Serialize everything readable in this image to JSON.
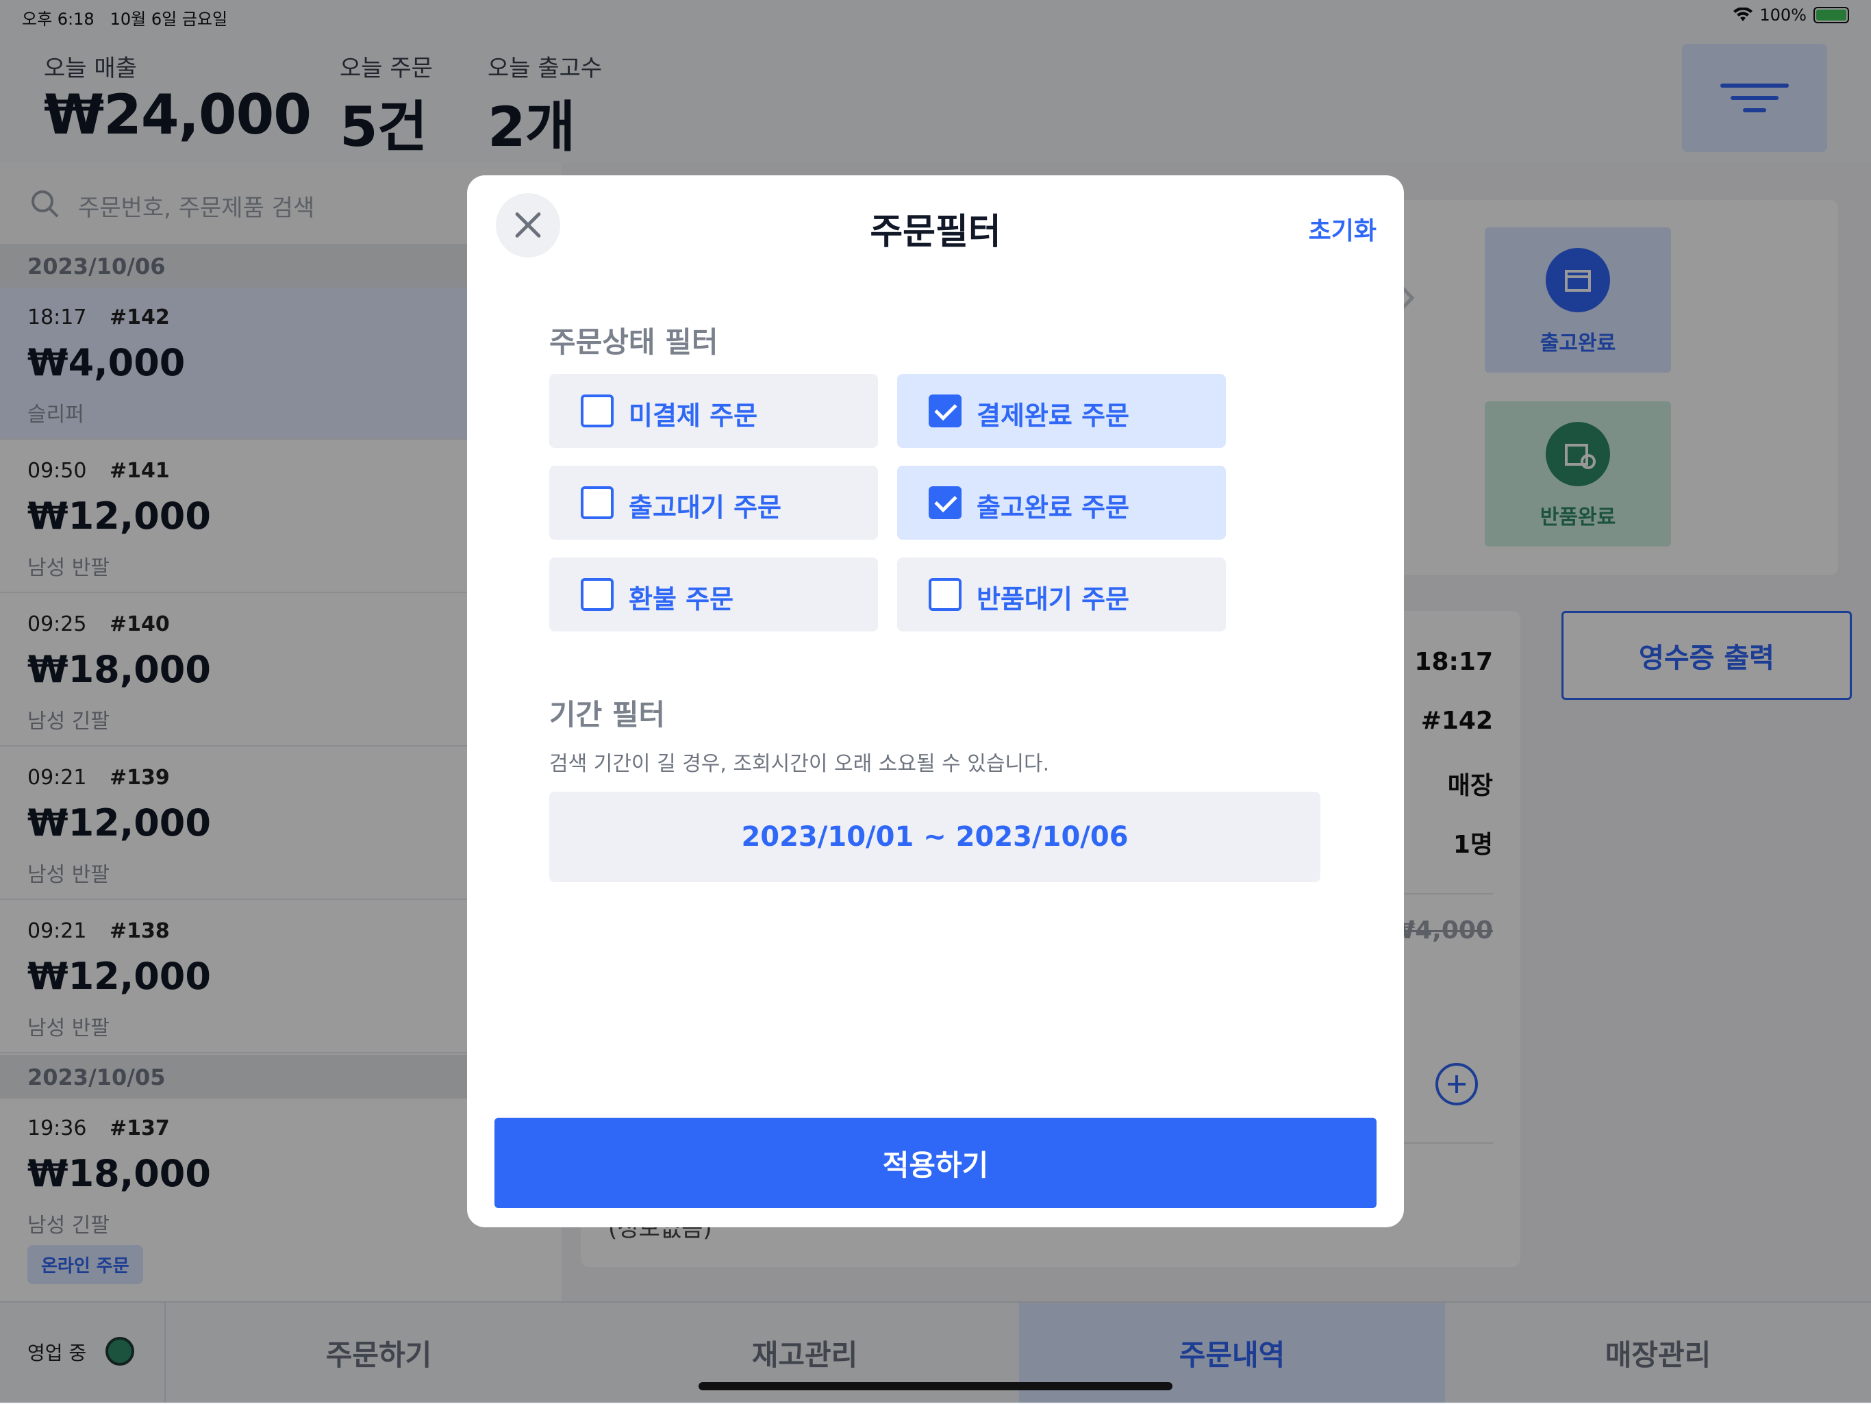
{
  "status_bar": {
    "time": "오후 6:18",
    "date": "10월 6일 금요일",
    "battery": "100%"
  },
  "header": {
    "sales_label": "오늘 매출",
    "sales_value": "₩24,000",
    "orders_label": "오늘 주문",
    "orders_value": "5건",
    "shipped_label": "오늘 출고수",
    "shipped_value": "2개"
  },
  "search": {
    "placeholder": "주문번호, 주문제품 검색"
  },
  "order_groups": [
    {
      "date": "2023/10/06",
      "orders": [
        {
          "time": "18:17",
          "number": "#142",
          "price": "₩4,000",
          "product": "슬리퍼"
        },
        {
          "time": "09:50",
          "number": "#141",
          "price": "₩12,000",
          "product": "남성 반팔"
        },
        {
          "time": "09:25",
          "number": "#140",
          "price": "₩18,000",
          "product": "남성 긴팔"
        },
        {
          "time": "09:21",
          "number": "#139",
          "price": "₩12,000",
          "product": "남성 반팔"
        },
        {
          "time": "09:21",
          "number": "#138",
          "price": "₩12,000",
          "product": "남성 반팔"
        }
      ]
    },
    {
      "date": "2023/10/05",
      "orders": [
        {
          "time": "19:36",
          "number": "#137",
          "price": "₩18,000",
          "product": "남성 긴팔",
          "tag": "온라인 주문"
        }
      ]
    }
  ],
  "detail": {
    "status_buttons": [
      {
        "label": "출고완료"
      },
      {
        "label": "반품완료"
      }
    ],
    "receipt_button": "영수증 출력",
    "rows": [
      "06, 18:17",
      "#142",
      "매장",
      "1명"
    ],
    "original_price": "₩4,000",
    "memo": "(정보없음)"
  },
  "modal": {
    "title": "주문필터",
    "reset": "초기화",
    "status_section": "주문상태 필터",
    "status_options": [
      {
        "label": "미결제 주문",
        "checked": false
      },
      {
        "label": "결제완료 주문",
        "checked": true
      },
      {
        "label": "출고대기 주문",
        "checked": false
      },
      {
        "label": "출고완료 주문",
        "checked": true
      },
      {
        "label": "환불 주문",
        "checked": false
      },
      {
        "label": "반품대기 주문",
        "checked": false
      }
    ],
    "period_section": "기간 필터",
    "period_desc": "검색 기간이 길 경우, 조회시간이 오래 소요될 수 있습니다.",
    "period_value": "2023/10/01 ~ 2023/10/06",
    "apply": "적용하기"
  },
  "tabbar": {
    "business_status": "영업 중",
    "tabs": [
      "주문하기",
      "재고관리",
      "주문내역",
      "매장관리"
    ],
    "active_tab": "주문내역"
  },
  "colors": {
    "accent": "#2f67f6",
    "selected_bg": "#dbe6ff",
    "return_green": "#2f8a6a"
  }
}
